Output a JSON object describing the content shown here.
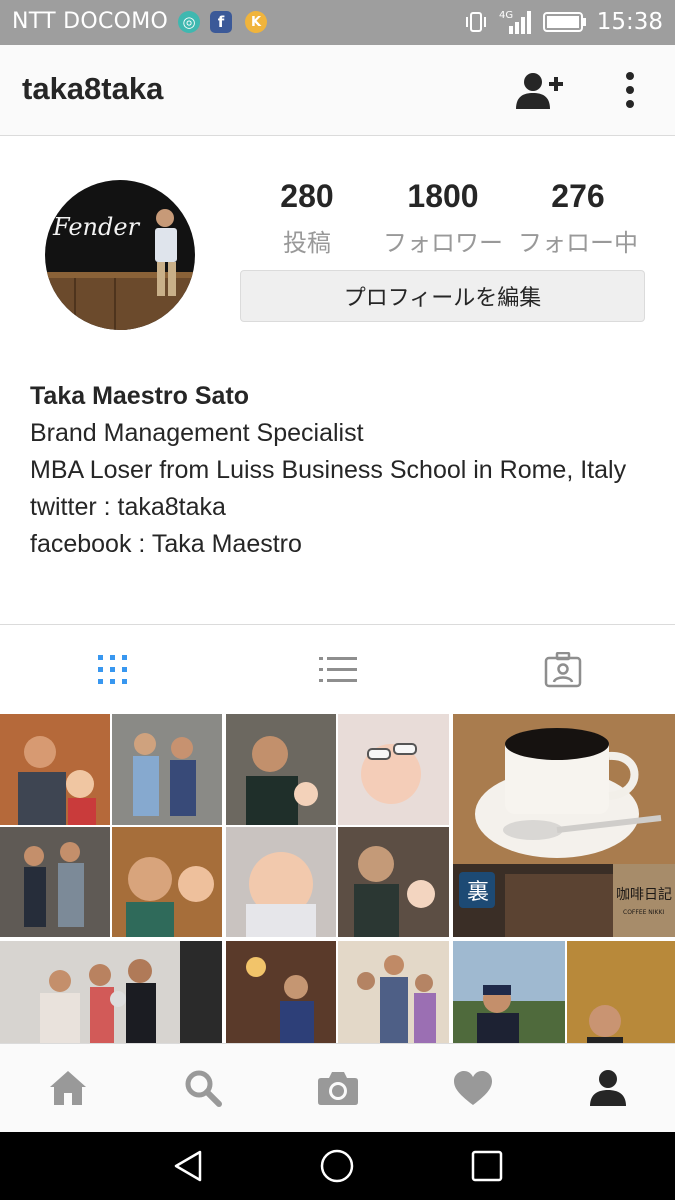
{
  "status_bar": {
    "carrier": "NTT DOCOMO",
    "network": "4G",
    "time": "15:38",
    "icons": [
      "app-notification-icon",
      "facebook-icon",
      "k-app-icon",
      "vibrate-icon",
      "signal-icon",
      "battery-icon"
    ]
  },
  "header": {
    "username": "taka8taka",
    "icons": [
      "add-user-icon",
      "more-vertical-icon"
    ]
  },
  "profile": {
    "stats": {
      "posts_count": "280",
      "posts_label": "投稿",
      "followers_count": "1800",
      "followers_label": "フォロワー",
      "following_count": "276",
      "following_label": "フォロー中"
    },
    "edit_button": "プロフィールを編集",
    "avatar_sign": "Fender"
  },
  "bio": {
    "name": "Taka Maestro Sato",
    "lines": [
      "Brand Management Specialist",
      "MBA Loser from Luiss Business School in Rome, Italy",
      "twitter : taka8taka",
      "facebook : Taka Maestro"
    ]
  },
  "tabs": {
    "items": [
      "grid-icon",
      "list-icon",
      "tagged-icon"
    ],
    "active": "grid",
    "active_color": "#3897f0"
  },
  "grid": {
    "sign_text": "咖啡日記",
    "sign_sub": "COFFEE NIKKI",
    "sign_kanji": "裏"
  },
  "bottom_nav": {
    "items": [
      "home-icon",
      "search-icon",
      "camera-icon",
      "heart-icon",
      "profile-icon"
    ],
    "active": "profile"
  },
  "android_nav": [
    "back-icon",
    "home-circle-icon",
    "recents-icon"
  ],
  "colors": {
    "status_bar": "#9e9e9e",
    "header_bg": "#fafafa",
    "text": "#262626",
    "muted": "#999999",
    "accent": "#3897f0"
  }
}
